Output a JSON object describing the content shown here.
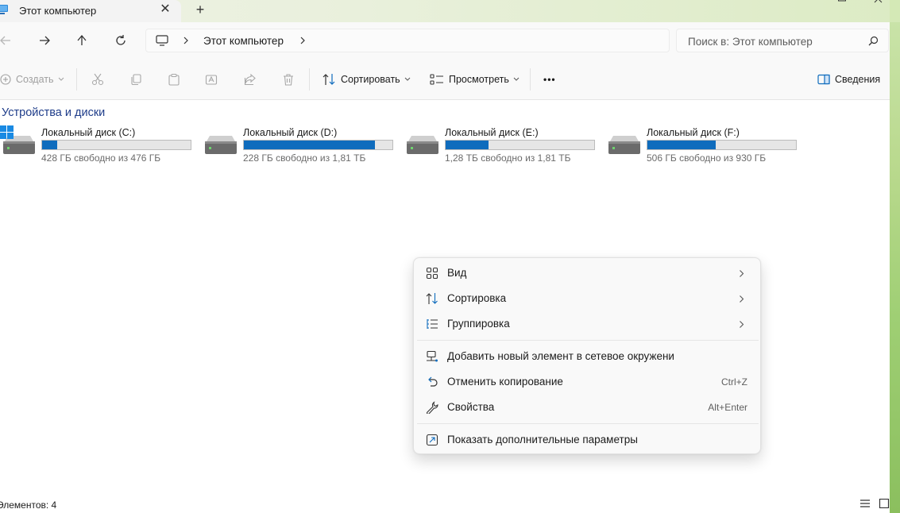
{
  "window": {
    "tab_title": "Этот компьютер",
    "new_tab": "+",
    "close_tab": "✕"
  },
  "address": {
    "location": "Этот компьютер"
  },
  "search": {
    "placeholder": "Поиск в: Этот компьютер"
  },
  "commands": {
    "create": "Создать",
    "sort": "Сортировать",
    "view": "Просмотреть",
    "more": "•••",
    "details": "Сведения"
  },
  "content": {
    "group_title": "Устройства и диски",
    "drives": [
      {
        "name": "Локальный диск (C:)",
        "free": "428 ГБ свободно из 476 ГБ",
        "used_fraction": 0.1
      },
      {
        "name": "Локальный диск (D:)",
        "free": "228 ГБ свободно из 1,81 ТБ",
        "used_fraction": 0.88
      },
      {
        "name": "Локальный диск (E:)",
        "free": "1,28 ТБ свободно из 1,81 ТБ",
        "used_fraction": 0.29
      },
      {
        "name": "Локальный диск (F:)",
        "free": "506 ГБ свободно из 930 ГБ",
        "used_fraction": 0.46
      }
    ]
  },
  "status": {
    "items_count": "Элементов: 4"
  },
  "context_menu": {
    "items": [
      {
        "label": "Вид",
        "shortcut": ""
      },
      {
        "label": "Сортировка",
        "shortcut": ""
      },
      {
        "label": "Группировка",
        "shortcut": ""
      },
      {
        "label": "Добавить новый элемент в сетевое окружени",
        "shortcut": ""
      },
      {
        "label": "Отменить копирование",
        "shortcut": "Ctrl+Z"
      },
      {
        "label": "Свойства",
        "shortcut": "Alt+Enter"
      },
      {
        "label": "Показать дополнительные параметры",
        "shortcut": ""
      }
    ]
  },
  "colors": {
    "accent": "#0f6cbd",
    "group_title": "#1f3d8a",
    "menu_bg": "#f9f9f9"
  }
}
